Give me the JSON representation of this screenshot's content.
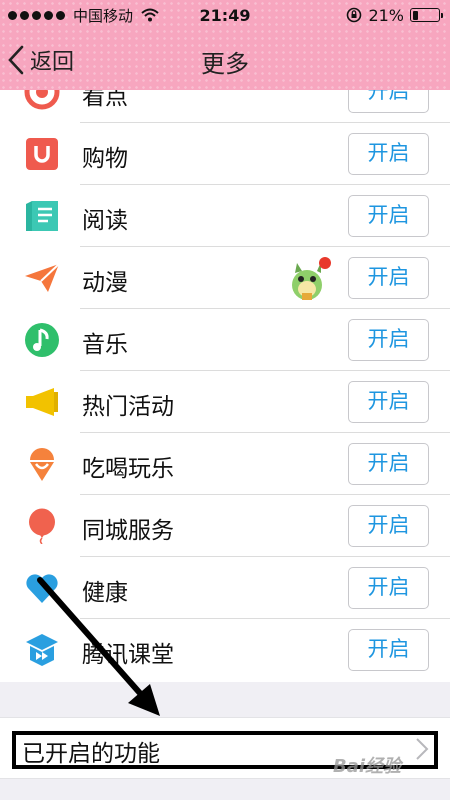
{
  "status_bar": {
    "carrier": "中国移动",
    "time": "21:49",
    "battery_percent_text": "21%",
    "battery_level": 0.21
  },
  "nav": {
    "back_label": "返回",
    "title": "更多"
  },
  "features": [
    {
      "label": "看点",
      "button": "开启",
      "icon": "kandian-icon",
      "color": "#ef5a4e"
    },
    {
      "label": "购物",
      "button": "开启",
      "icon": "shopping-bag-icon",
      "color": "#ef5a4e"
    },
    {
      "label": "阅读",
      "button": "开启",
      "icon": "book-icon",
      "color": "#3cc8b4"
    },
    {
      "label": "动漫",
      "button": "开启",
      "icon": "paper-plane-icon",
      "color": "#f5763c"
    },
    {
      "label": "音乐",
      "button": "开启",
      "icon": "music-note-icon",
      "color": "#2fbf6b"
    },
    {
      "label": "热门活动",
      "button": "开启",
      "icon": "megaphone-icon",
      "color": "#f2c200"
    },
    {
      "label": "吃喝玩乐",
      "button": "开启",
      "icon": "ice-cream-icon",
      "color": "#f5823c"
    },
    {
      "label": "同城服务",
      "button": "开启",
      "icon": "balloon-icon",
      "color": "#f0624e"
    },
    {
      "label": "健康",
      "button": "开启",
      "icon": "heart-icon",
      "color": "#2a9fe0"
    },
    {
      "label": "腾讯课堂",
      "button": "开启",
      "icon": "classroom-icon",
      "color": "#2a9fe0"
    }
  ],
  "enabled_section": {
    "label": "已开启的功能"
  },
  "watermark": "Bai经验"
}
